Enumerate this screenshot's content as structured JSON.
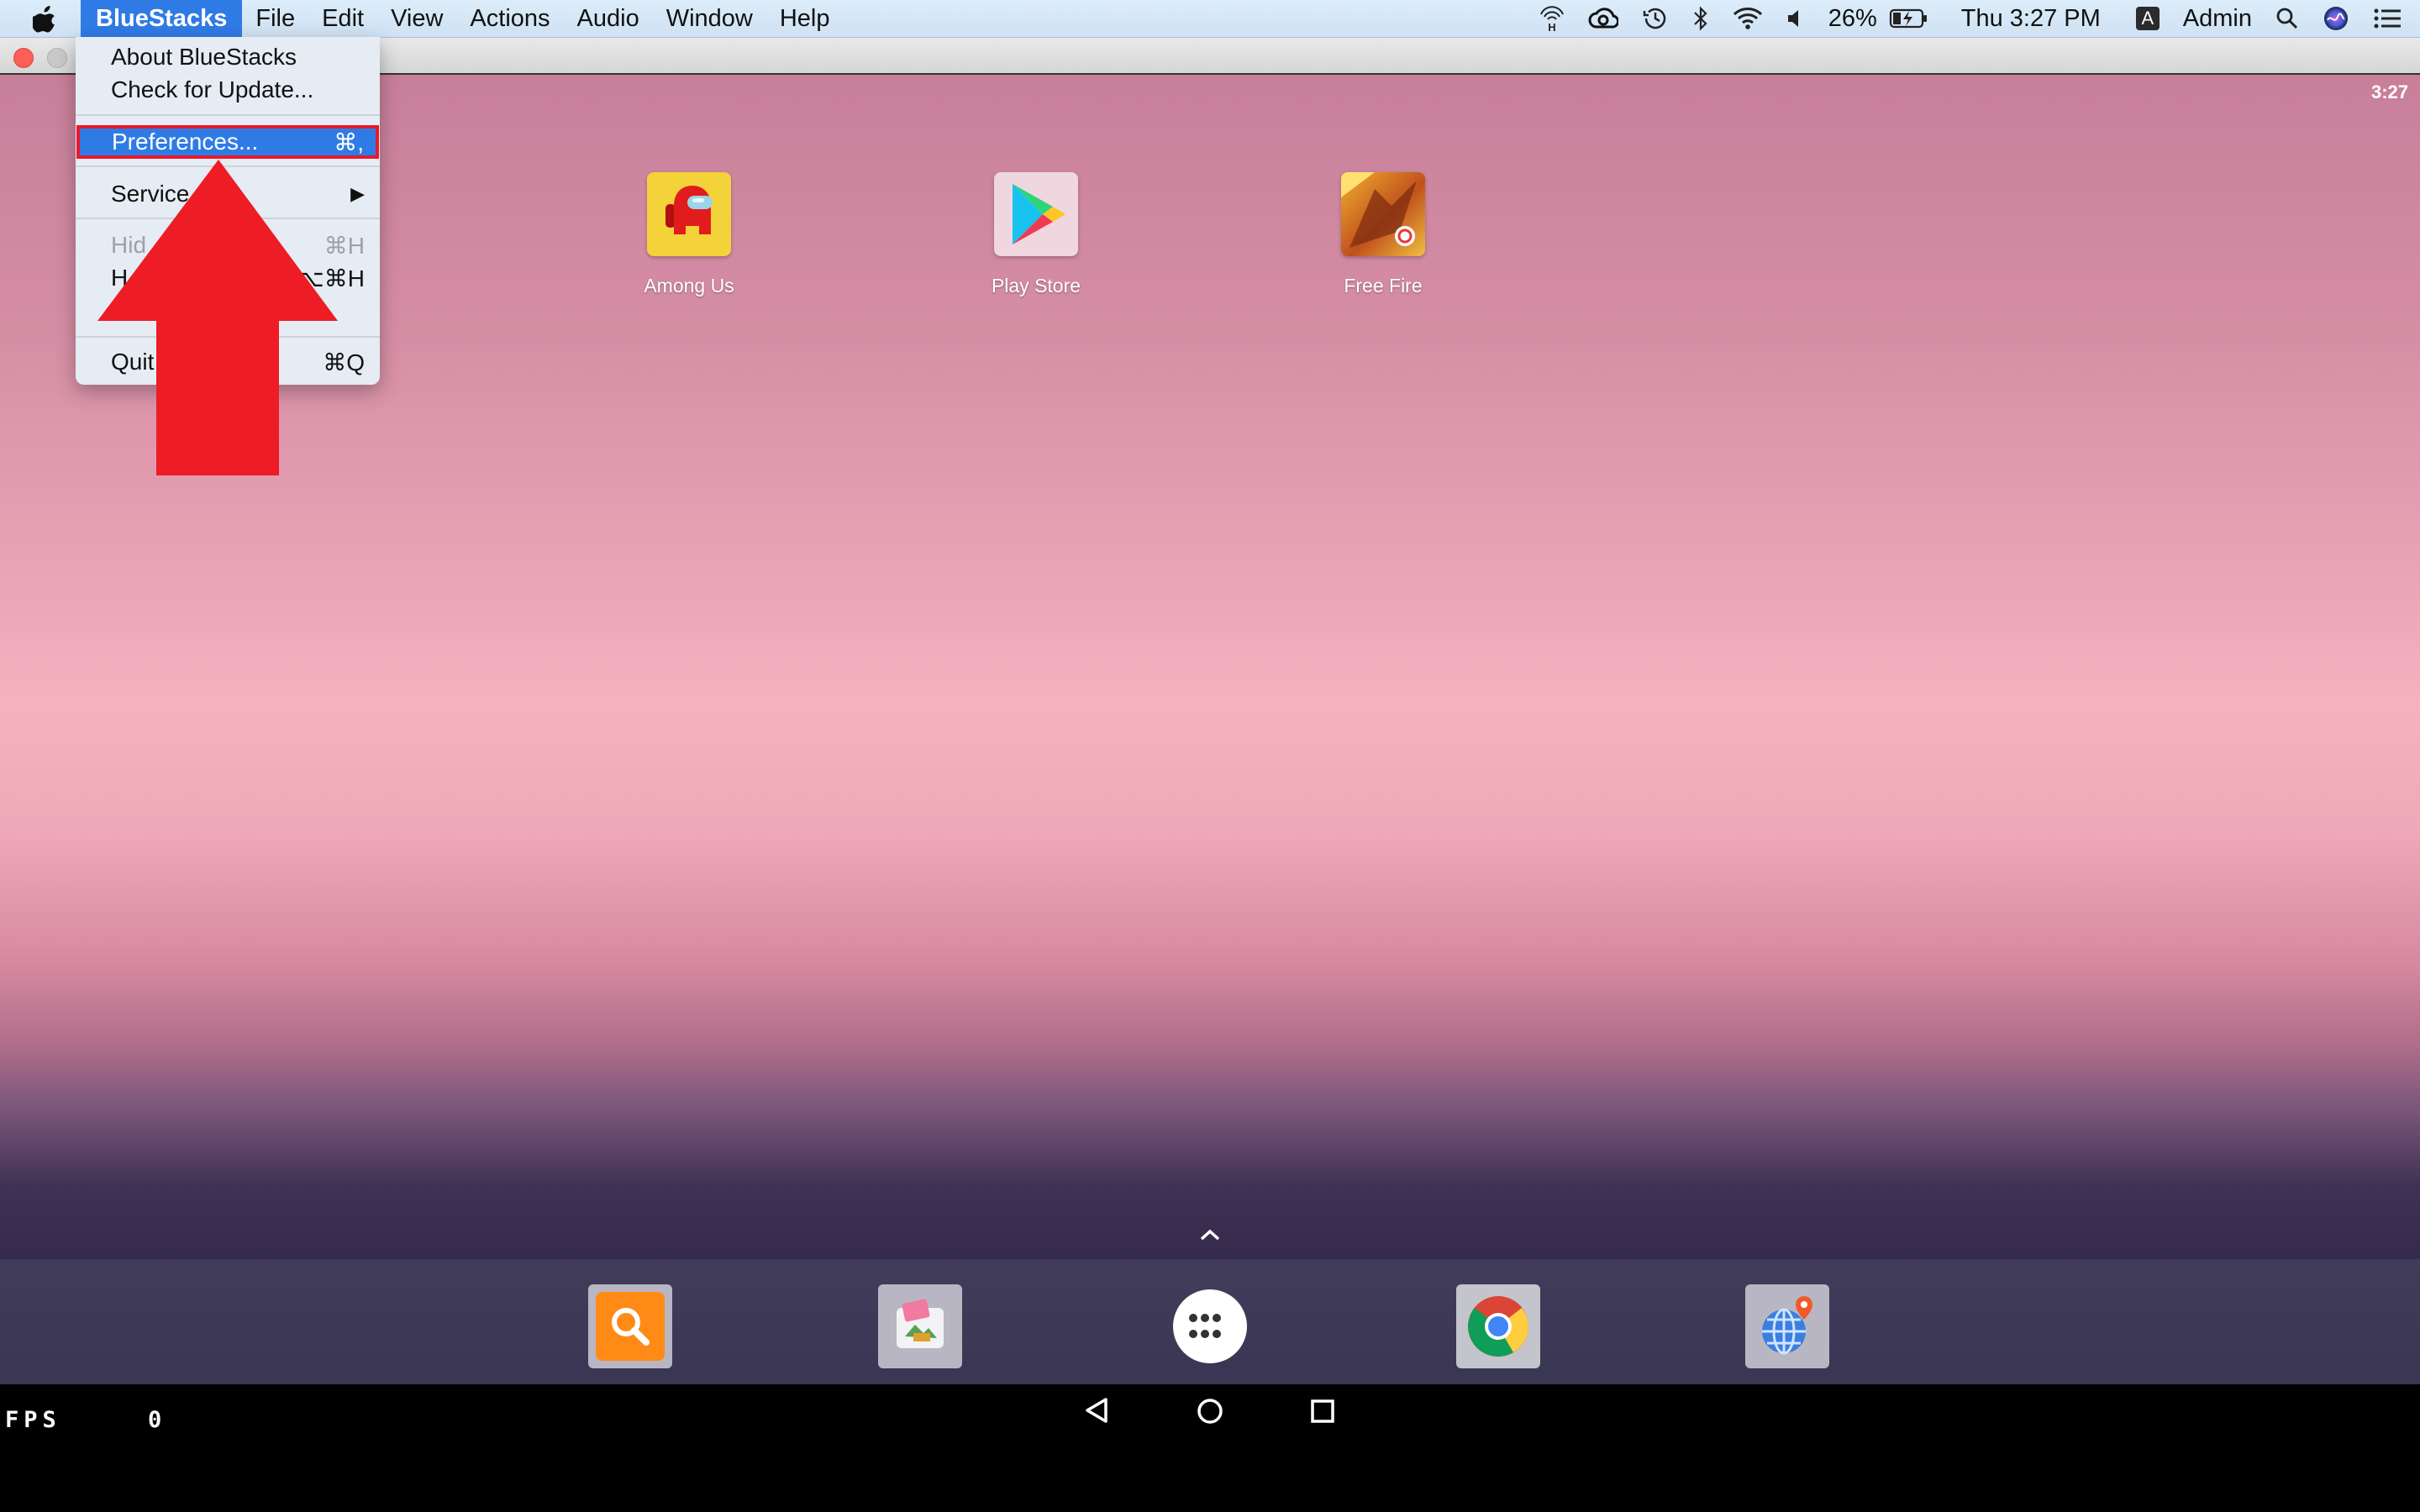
{
  "menubar": {
    "app_menu": "BlueStacks",
    "menus": [
      "File",
      "Edit",
      "View",
      "Actions",
      "Audio",
      "Window",
      "Help"
    ],
    "battery_percent": "26%",
    "clock": "Thu 3:27 PM",
    "input_source": "A",
    "user": "Admin"
  },
  "dropdown": {
    "about": "About BlueStacks",
    "check_update": "Check for Update...",
    "preferences": "Preferences...",
    "preferences_shortcut": "⌘,",
    "services": "Service",
    "services_arrow": "▶",
    "hide": "Hid",
    "hide_shortcut": "⌘H",
    "hide_others": "H",
    "hide_others_shortcut": "⌥⌘H",
    "quit_left": "Quit",
    "quit_right": "s",
    "quit_shortcut": "⌘Q"
  },
  "android": {
    "status_time": "3:27",
    "apps": [
      {
        "label": "Among Us",
        "icon": "among-us-icon"
      },
      {
        "label": "Play Store",
        "icon": "play-store-icon"
      },
      {
        "label": "Free Fire",
        "icon": "free-fire-icon"
      }
    ],
    "dock": [
      "search-icon",
      "gallery-icon",
      "app-drawer-icon",
      "chrome-icon",
      "maps-icon"
    ]
  },
  "overlay": {
    "fps_label": "FPS",
    "fps_value": "0"
  },
  "colors": {
    "menu_highlight": "#2f7be6",
    "annotation_red": "#e8192c"
  }
}
